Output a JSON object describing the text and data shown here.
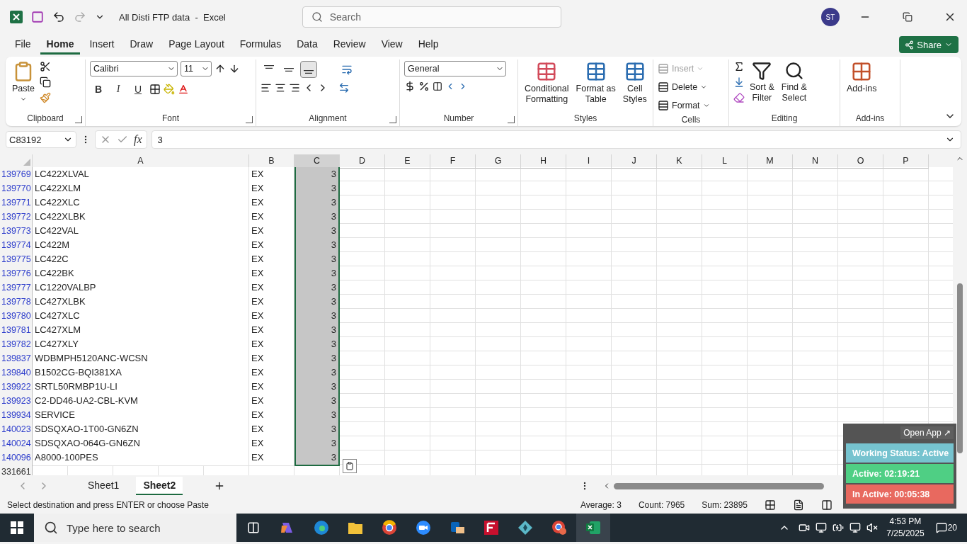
{
  "title_bar": {
    "title": "All Disti FTP data  -  Excel",
    "search": {
      "placeholder": "Search"
    },
    "user_initials": "ST"
  },
  "menu_tabs": [
    {
      "label": "File",
      "selected": false
    },
    {
      "label": "Home",
      "selected": true
    },
    {
      "label": "Insert",
      "selected": false
    },
    {
      "label": "Draw",
      "selected": false
    },
    {
      "label": "Page Layout",
      "selected": false
    },
    {
      "label": "Formulas",
      "selected": false
    },
    {
      "label": "Data",
      "selected": false
    },
    {
      "label": "Review",
      "selected": false
    },
    {
      "label": "View",
      "selected": false
    },
    {
      "label": "Help",
      "selected": false
    }
  ],
  "share_button": "Share",
  "ribbon": {
    "clipboard": {
      "label": "Clipboard",
      "paste": "Paste"
    },
    "font": {
      "label": "Font",
      "font_name": "Calibri",
      "font_size": "11",
      "bold": "B",
      "italic": "I",
      "underline": "U"
    },
    "alignment": {
      "label": "Alignment",
      "vertical_align": [
        {
          "selected": false
        },
        {
          "selected": false
        },
        {
          "selected": true
        }
      ]
    },
    "number": {
      "label": "Number",
      "format": "General"
    },
    "styles": {
      "label": "Styles",
      "buttons": [
        {
          "lines": [
            "Conditional",
            "Formatting"
          ]
        },
        {
          "lines": [
            "Format as",
            "Table"
          ]
        },
        {
          "lines": [
            "Cell",
            "Styles"
          ]
        }
      ]
    },
    "cells": {
      "label": "Cells",
      "buttons": [
        {
          "label": "Insert",
          "disabled": true
        },
        {
          "label": "Delete",
          "disabled": false
        },
        {
          "label": "Format",
          "disabled": false
        }
      ]
    },
    "editing": {
      "label": "Editing",
      "buttons": [
        {
          "lines": [
            "Sort &",
            "Filter"
          ]
        },
        {
          "lines": [
            "Find &",
            "Select"
          ]
        }
      ]
    },
    "addins": {
      "label": "Add-ins",
      "button": "Add-ins"
    }
  },
  "formula_bar": {
    "name_box": "C83192",
    "fx": "fx",
    "value": "3"
  },
  "columns": [
    {
      "label": "A",
      "selected": false
    },
    {
      "label": "B",
      "selected": false
    },
    {
      "label": "C",
      "selected": true
    },
    {
      "label": "D",
      "selected": false
    },
    {
      "label": "E",
      "selected": false
    },
    {
      "label": "F",
      "selected": false
    },
    {
      "label": "G",
      "selected": false
    },
    {
      "label": "H",
      "selected": false
    },
    {
      "label": "I",
      "selected": false
    },
    {
      "label": "J",
      "selected": false
    },
    {
      "label": "K",
      "selected": false
    },
    {
      "label": "L",
      "selected": false
    },
    {
      "label": "M",
      "selected": false
    },
    {
      "label": "N",
      "selected": false
    },
    {
      "label": "O",
      "selected": false
    },
    {
      "label": "P",
      "selected": false
    }
  ],
  "rows": [
    {
      "row": "139769",
      "a": "LC422XLVAL",
      "b": "EX",
      "c": "3",
      "selected": true
    },
    {
      "row": "139770",
      "a": "LC422XLM",
      "b": "EX",
      "c": "3",
      "selected": true
    },
    {
      "row": "139771",
      "a": "LC422XLC",
      "b": "EX",
      "c": "3",
      "selected": true
    },
    {
      "row": "139772",
      "a": "LC422XLBK",
      "b": "EX",
      "c": "3",
      "selected": true
    },
    {
      "row": "139773",
      "a": "LC422VAL",
      "b": "EX",
      "c": "3",
      "selected": true
    },
    {
      "row": "139774",
      "a": "LC422M",
      "b": "EX",
      "c": "3",
      "selected": true
    },
    {
      "row": "139775",
      "a": "LC422C",
      "b": "EX",
      "c": "3",
      "selected": true
    },
    {
      "row": "139776",
      "a": "LC422BK",
      "b": "EX",
      "c": "3",
      "selected": true
    },
    {
      "row": "139777",
      "a": "LC1220VALBP",
      "b": "EX",
      "c": "3",
      "selected": true
    },
    {
      "row": "139778",
      "a": "LC427XLBK",
      "b": "EX",
      "c": "3",
      "selected": true
    },
    {
      "row": "139780",
      "a": "LC427XLC",
      "b": "EX",
      "c": "3",
      "selected": true
    },
    {
      "row": "139781",
      "a": "LC427XLM",
      "b": "EX",
      "c": "3",
      "selected": true
    },
    {
      "row": "139782",
      "a": "LC427XLY",
      "b": "EX",
      "c": "3",
      "selected": true
    },
    {
      "row": "139837",
      "a": "WDBMPH5120ANC-WCSN",
      "b": "EX",
      "c": "3",
      "selected": true
    },
    {
      "row": "139840",
      "a": "B1502CG-BQI381XA",
      "b": "EX",
      "c": "3",
      "selected": true
    },
    {
      "row": "139922",
      "a": "SRTL50RMBP1U-LI",
      "b": "EX",
      "c": "3",
      "selected": true
    },
    {
      "row": "139923",
      "a": "C2-DD46-UA2-CBL-KVM",
      "b": "EX",
      "c": "3",
      "selected": true
    },
    {
      "row": "139934",
      "a": "SERVICE",
      "b": "EX",
      "c": "3",
      "selected": true
    },
    {
      "row": "140023",
      "a": "SDSQXAO-1T00-GN6ZN",
      "b": "EX",
      "c": "3",
      "selected": true
    },
    {
      "row": "140024",
      "a": "SDSQXAO-064G-GN6ZN",
      "b": "EX",
      "c": "3",
      "selected": true
    },
    {
      "row": "140096",
      "a": "A8000-100PES",
      "b": "EX",
      "c": "3",
      "selected": true
    }
  ],
  "partial_row": "331661",
  "sheet_tabs": [
    {
      "label": "Sheet1",
      "selected": false
    },
    {
      "label": "Sheet2",
      "selected": true
    }
  ],
  "status_bar": {
    "message": "Select destination and press ENTER or choose Paste",
    "average": "Average: 3",
    "count": "Count: 7965",
    "sum": "Sum: 23895"
  },
  "tracker": {
    "open_app": "Open App ↗",
    "items": [
      {
        "text": "Working Status: Active",
        "color": "#76c3cf"
      },
      {
        "text": "Active: 02:19:21",
        "color": "#4fcf84"
      },
      {
        "text": "In Active: 00:05:38",
        "color": "#e8695f"
      }
    ]
  },
  "taskbar": {
    "search": {
      "placeholder": "Type here to search"
    },
    "time": "4:53 PM",
    "date": "7/25/2025",
    "notifications": "20"
  }
}
